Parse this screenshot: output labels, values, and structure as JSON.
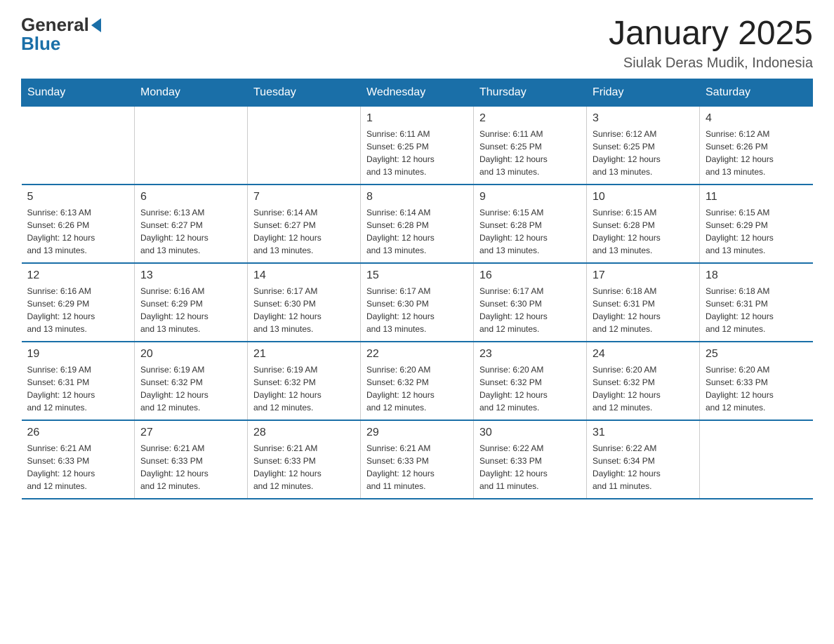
{
  "header": {
    "month_title": "January 2025",
    "location": "Siulak Deras Mudik, Indonesia",
    "logo_general": "General",
    "logo_blue": "Blue"
  },
  "weekdays": [
    "Sunday",
    "Monday",
    "Tuesday",
    "Wednesday",
    "Thursday",
    "Friday",
    "Saturday"
  ],
  "weeks": [
    [
      {
        "day": "",
        "info": ""
      },
      {
        "day": "",
        "info": ""
      },
      {
        "day": "",
        "info": ""
      },
      {
        "day": "1",
        "info": "Sunrise: 6:11 AM\nSunset: 6:25 PM\nDaylight: 12 hours\nand 13 minutes."
      },
      {
        "day": "2",
        "info": "Sunrise: 6:11 AM\nSunset: 6:25 PM\nDaylight: 12 hours\nand 13 minutes."
      },
      {
        "day": "3",
        "info": "Sunrise: 6:12 AM\nSunset: 6:25 PM\nDaylight: 12 hours\nand 13 minutes."
      },
      {
        "day": "4",
        "info": "Sunrise: 6:12 AM\nSunset: 6:26 PM\nDaylight: 12 hours\nand 13 minutes."
      }
    ],
    [
      {
        "day": "5",
        "info": "Sunrise: 6:13 AM\nSunset: 6:26 PM\nDaylight: 12 hours\nand 13 minutes."
      },
      {
        "day": "6",
        "info": "Sunrise: 6:13 AM\nSunset: 6:27 PM\nDaylight: 12 hours\nand 13 minutes."
      },
      {
        "day": "7",
        "info": "Sunrise: 6:14 AM\nSunset: 6:27 PM\nDaylight: 12 hours\nand 13 minutes."
      },
      {
        "day": "8",
        "info": "Sunrise: 6:14 AM\nSunset: 6:28 PM\nDaylight: 12 hours\nand 13 minutes."
      },
      {
        "day": "9",
        "info": "Sunrise: 6:15 AM\nSunset: 6:28 PM\nDaylight: 12 hours\nand 13 minutes."
      },
      {
        "day": "10",
        "info": "Sunrise: 6:15 AM\nSunset: 6:28 PM\nDaylight: 12 hours\nand 13 minutes."
      },
      {
        "day": "11",
        "info": "Sunrise: 6:15 AM\nSunset: 6:29 PM\nDaylight: 12 hours\nand 13 minutes."
      }
    ],
    [
      {
        "day": "12",
        "info": "Sunrise: 6:16 AM\nSunset: 6:29 PM\nDaylight: 12 hours\nand 13 minutes."
      },
      {
        "day": "13",
        "info": "Sunrise: 6:16 AM\nSunset: 6:29 PM\nDaylight: 12 hours\nand 13 minutes."
      },
      {
        "day": "14",
        "info": "Sunrise: 6:17 AM\nSunset: 6:30 PM\nDaylight: 12 hours\nand 13 minutes."
      },
      {
        "day": "15",
        "info": "Sunrise: 6:17 AM\nSunset: 6:30 PM\nDaylight: 12 hours\nand 13 minutes."
      },
      {
        "day": "16",
        "info": "Sunrise: 6:17 AM\nSunset: 6:30 PM\nDaylight: 12 hours\nand 12 minutes."
      },
      {
        "day": "17",
        "info": "Sunrise: 6:18 AM\nSunset: 6:31 PM\nDaylight: 12 hours\nand 12 minutes."
      },
      {
        "day": "18",
        "info": "Sunrise: 6:18 AM\nSunset: 6:31 PM\nDaylight: 12 hours\nand 12 minutes."
      }
    ],
    [
      {
        "day": "19",
        "info": "Sunrise: 6:19 AM\nSunset: 6:31 PM\nDaylight: 12 hours\nand 12 minutes."
      },
      {
        "day": "20",
        "info": "Sunrise: 6:19 AM\nSunset: 6:32 PM\nDaylight: 12 hours\nand 12 minutes."
      },
      {
        "day": "21",
        "info": "Sunrise: 6:19 AM\nSunset: 6:32 PM\nDaylight: 12 hours\nand 12 minutes."
      },
      {
        "day": "22",
        "info": "Sunrise: 6:20 AM\nSunset: 6:32 PM\nDaylight: 12 hours\nand 12 minutes."
      },
      {
        "day": "23",
        "info": "Sunrise: 6:20 AM\nSunset: 6:32 PM\nDaylight: 12 hours\nand 12 minutes."
      },
      {
        "day": "24",
        "info": "Sunrise: 6:20 AM\nSunset: 6:32 PM\nDaylight: 12 hours\nand 12 minutes."
      },
      {
        "day": "25",
        "info": "Sunrise: 6:20 AM\nSunset: 6:33 PM\nDaylight: 12 hours\nand 12 minutes."
      }
    ],
    [
      {
        "day": "26",
        "info": "Sunrise: 6:21 AM\nSunset: 6:33 PM\nDaylight: 12 hours\nand 12 minutes."
      },
      {
        "day": "27",
        "info": "Sunrise: 6:21 AM\nSunset: 6:33 PM\nDaylight: 12 hours\nand 12 minutes."
      },
      {
        "day": "28",
        "info": "Sunrise: 6:21 AM\nSunset: 6:33 PM\nDaylight: 12 hours\nand 12 minutes."
      },
      {
        "day": "29",
        "info": "Sunrise: 6:21 AM\nSunset: 6:33 PM\nDaylight: 12 hours\nand 11 minutes."
      },
      {
        "day": "30",
        "info": "Sunrise: 6:22 AM\nSunset: 6:33 PM\nDaylight: 12 hours\nand 11 minutes."
      },
      {
        "day": "31",
        "info": "Sunrise: 6:22 AM\nSunset: 6:34 PM\nDaylight: 12 hours\nand 11 minutes."
      },
      {
        "day": "",
        "info": ""
      }
    ]
  ]
}
